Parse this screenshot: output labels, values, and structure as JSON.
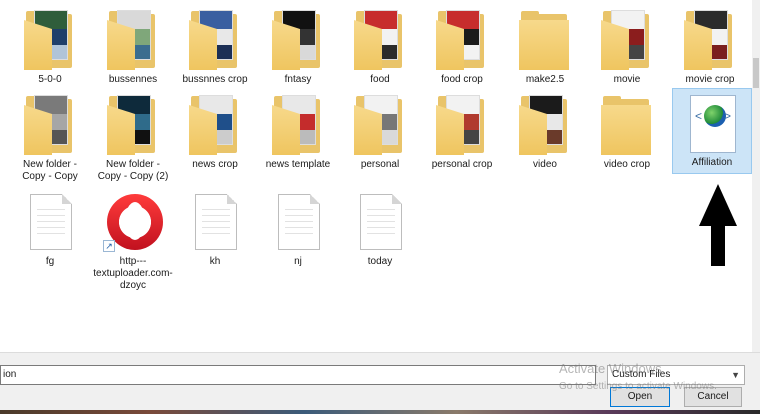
{
  "files": [
    {
      "label": "5-0-0",
      "kind": "folder",
      "colors": [
        "#2f5d3b",
        "#1f3f6a",
        "#b0c4d8"
      ]
    },
    {
      "label": "bussennes",
      "kind": "folder",
      "colors": [
        "#d9d9d9",
        "#7fa77a",
        "#3b6d8f"
      ]
    },
    {
      "label": "bussnnes crop",
      "kind": "folder",
      "colors": [
        "#3a5fa0",
        "#e8e8e8",
        "#1c2f55"
      ]
    },
    {
      "label": "fntasy",
      "kind": "folder",
      "colors": [
        "#111111",
        "#333333",
        "#d9d9d9"
      ]
    },
    {
      "label": "food",
      "kind": "folder",
      "colors": [
        "#c72d2d",
        "#f2f2f2",
        "#2b2b2b"
      ]
    },
    {
      "label": "food crop",
      "kind": "folder",
      "colors": [
        "#c72d2d",
        "#1b1b1b",
        "#f2f2f2"
      ]
    },
    {
      "label": "make2.5",
      "kind": "folder-plain",
      "colors": []
    },
    {
      "label": "movie",
      "kind": "folder",
      "colors": [
        "#f2f2f2",
        "#8b1d1d",
        "#444444"
      ]
    },
    {
      "label": "movie crop",
      "kind": "folder",
      "colors": [
        "#2b2b2b",
        "#f2f2f2",
        "#7a1f1f"
      ]
    },
    {
      "label": "New folder - Copy - Copy",
      "kind": "folder",
      "colors": [
        "#7a7a7a",
        "#a6a6a6",
        "#555555"
      ]
    },
    {
      "label": "New folder - Copy - Copy (2)",
      "kind": "folder",
      "colors": [
        "#0e2a3b",
        "#2f6b8a",
        "#111111"
      ]
    },
    {
      "label": "news crop",
      "kind": "folder",
      "colors": [
        "#e8e8e8",
        "#1f4f8a",
        "#cccccc"
      ]
    },
    {
      "label": "news template",
      "kind": "folder",
      "colors": [
        "#e8e8e8",
        "#c42c2c",
        "#bbbbbb"
      ]
    },
    {
      "label": "personal",
      "kind": "folder",
      "colors": [
        "#f2f2f2",
        "#777777",
        "#d9d9d9"
      ]
    },
    {
      "label": "personal crop",
      "kind": "folder",
      "colors": [
        "#f2f2f2",
        "#b03a2e",
        "#444444"
      ]
    },
    {
      "label": "video",
      "kind": "folder",
      "colors": [
        "#1b1b1b",
        "#e8e8e8",
        "#6a3a2a"
      ]
    },
    {
      "label": "video crop",
      "kind": "folder-plain",
      "colors": []
    },
    {
      "label": "Affiliation",
      "kind": "html",
      "selected": true
    },
    {
      "label": "fg",
      "kind": "doc"
    },
    {
      "label": "http---textuploader.com-dzoyc",
      "kind": "opera"
    },
    {
      "label": "kh",
      "kind": "doc"
    },
    {
      "label": "nj",
      "kind": "doc"
    },
    {
      "label": "today",
      "kind": "doc"
    }
  ],
  "filename_value": "ion",
  "filetype_value": "Custom Files",
  "open_label": "Open",
  "cancel_label": "Cancel",
  "watermark": {
    "title": "Activate Windows",
    "subtitle": "Go to Settings to activate Windows."
  }
}
